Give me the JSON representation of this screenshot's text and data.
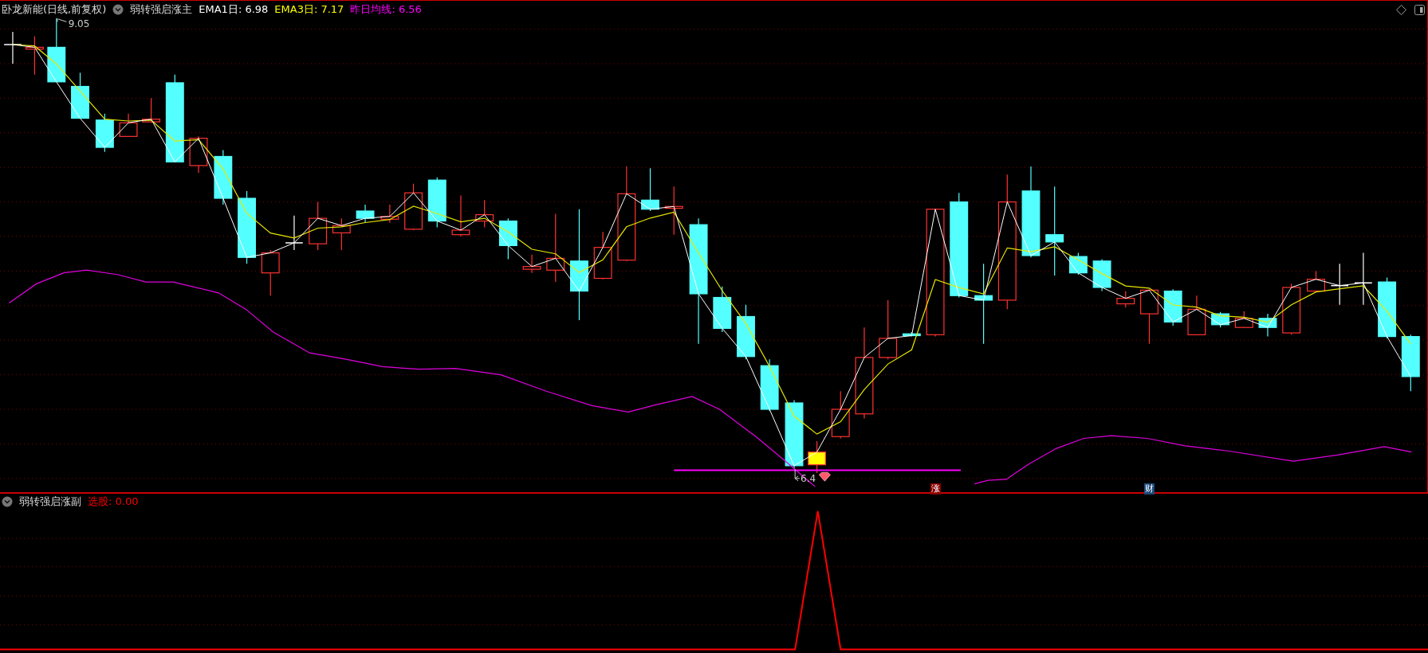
{
  "main_panel": {
    "title": "卧龙新能(日线,前复权)",
    "indicator": "弱转强启涨主",
    "legend": [
      {
        "text": "EMA1日: 6.98",
        "color": "#ffffff"
      },
      {
        "text": "EMA3日: 7.17",
        "color": "#ffff00"
      },
      {
        "text": "昨日均线: 6.56",
        "color": "#ff00ff"
      }
    ],
    "price_labels": [
      {
        "text": "9.05"
      },
      {
        "text": "6.4"
      }
    ],
    "signal_badges": [
      {
        "text": "涨",
        "color": "#8b0000"
      },
      {
        "text": "财",
        "color": "#1d4a7a"
      }
    ]
  },
  "sub_panel": {
    "indicator": "弱转强启涨副",
    "legend": [
      {
        "text": "选股: 0.00",
        "color": "#ff0000"
      }
    ]
  }
}
